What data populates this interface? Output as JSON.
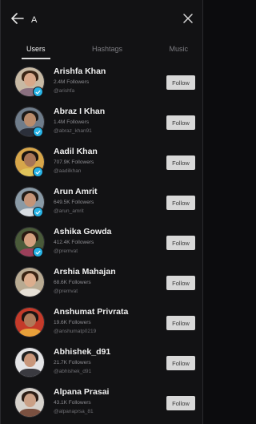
{
  "search": {
    "value": "A"
  },
  "tabs": [
    {
      "label": "Users",
      "active": true
    },
    {
      "label": "Hashtags",
      "active": false
    },
    {
      "label": "Music",
      "active": false
    }
  ],
  "colors": {
    "background": "#121214",
    "verified_badge": "#27b3e6",
    "follow_button": "#d8d8d8"
  },
  "users": [
    {
      "name": "Arishfa Khan",
      "followers": "2.4M Followers",
      "username": "@arishfa",
      "verified": true,
      "follow_label": "Follow"
    },
    {
      "name": "Abraz I Khan",
      "followers": "1.4M Followers",
      "username": "@abraz_khan91",
      "verified": true,
      "follow_label": "Follow"
    },
    {
      "name": "Aadil Khan",
      "followers": "707.9K Followers",
      "username": "@aadilkhan",
      "verified": true,
      "follow_label": "Follow"
    },
    {
      "name": "Arun Amrit",
      "followers": "649.5K Followers",
      "username": "@arun_amrit",
      "verified": true,
      "follow_label": "Follow"
    },
    {
      "name": "Ashika Gowda",
      "followers": "412.4K Followers",
      "username": "@premvat",
      "verified": true,
      "follow_label": "Follow"
    },
    {
      "name": "Arshia Mahajan",
      "followers": "68.6K Followers",
      "username": "@premvat",
      "verified": false,
      "follow_label": "Follow"
    },
    {
      "name": "Anshumat Privrata",
      "followers": "19.6K Followers",
      "username": "@anshumatp0219",
      "verified": false,
      "follow_label": "Follow"
    },
    {
      "name": "Abhishek_d91",
      "followers": "21.7K Followers",
      "username": "@abhishek_d91",
      "verified": false,
      "follow_label": "Follow"
    },
    {
      "name": "Alpana Prasai",
      "followers": "43.1K Followers",
      "username": "@alpanaprsa_81",
      "verified": false,
      "follow_label": "Follow"
    }
  ]
}
